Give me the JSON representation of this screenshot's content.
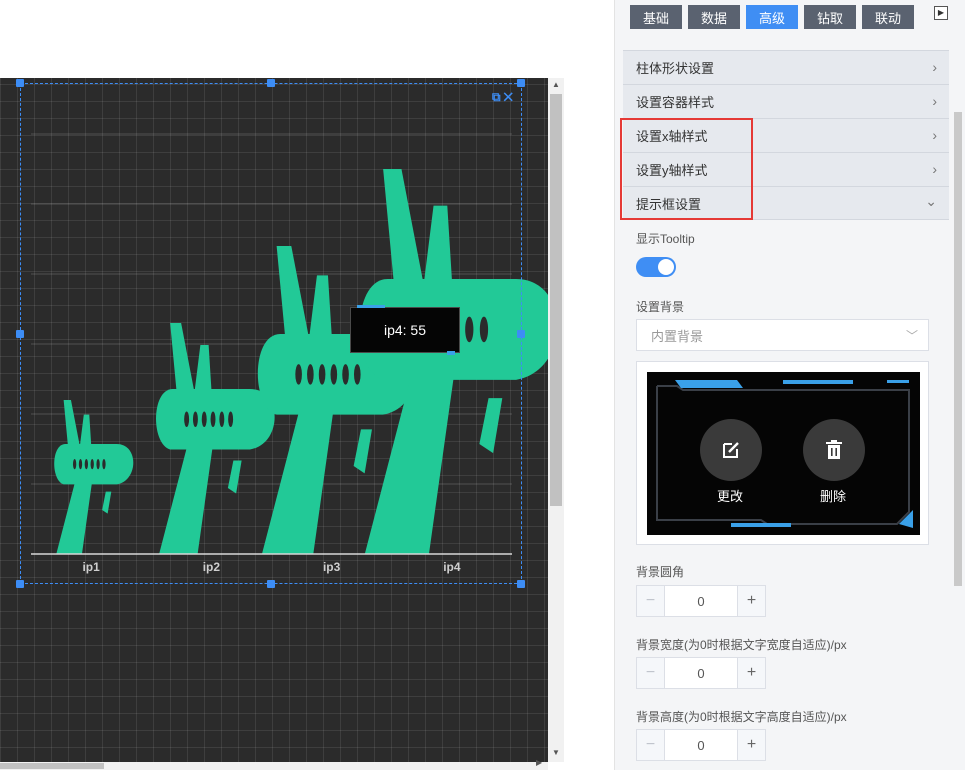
{
  "tabs": [
    {
      "label": "基础",
      "active": false
    },
    {
      "label": "数据",
      "active": false
    },
    {
      "label": "高级",
      "active": true
    },
    {
      "label": "钻取",
      "active": false
    },
    {
      "label": "联动",
      "active": false
    }
  ],
  "sections": [
    {
      "label": "柱体形状设置",
      "expanded": false
    },
    {
      "label": "设置容器样式",
      "expanded": false
    },
    {
      "label": "设置x轴样式",
      "expanded": false
    },
    {
      "label": "设置y轴样式",
      "expanded": false
    },
    {
      "label": "提示框设置",
      "expanded": true
    }
  ],
  "tooltip_settings": {
    "show_label": "显示Tooltip",
    "show_value": true,
    "bg_label": "设置背景",
    "bg_select": "内置背景",
    "change_label": "更改",
    "delete_label": "删除",
    "radius_label": "背景圆角",
    "radius_value": "0",
    "width_label": "背景宽度(为0时根据文字宽度自适应)/px",
    "width_value": "0",
    "height_label": "背景高度(为0时根据文字高度自适应)/px",
    "height_value": "0"
  },
  "chart_tooltip": {
    "text": "ip4: 55"
  },
  "colors": {
    "bar": "#22c997",
    "accent": "#3f8ef4",
    "highlight": "#e53935"
  },
  "chart_data": {
    "type": "bar",
    "categories": [
      "ip1",
      "ip2",
      "ip3",
      "ip4"
    ],
    "values": [
      22,
      33,
      44,
      55
    ],
    "ylim": [
      0,
      60
    ],
    "grid": true,
    "bar_shape": "airplane-icon"
  }
}
